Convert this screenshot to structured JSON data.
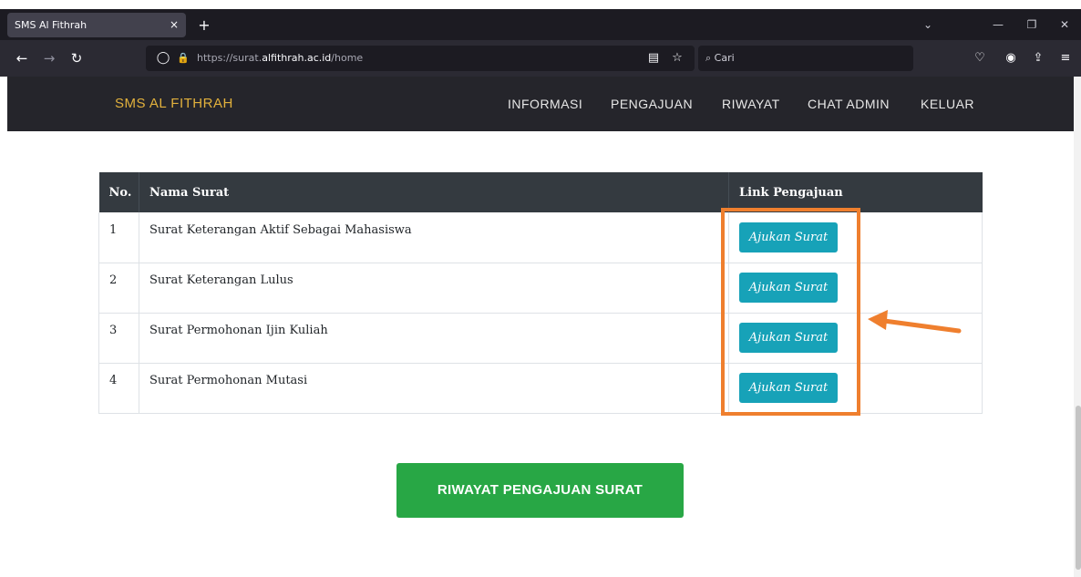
{
  "browser": {
    "tab_title": "SMS Al Fithrah",
    "tab_close": "×",
    "new_tab": "+",
    "url_prefix": "https://surat.",
    "url_domain": "alfithrah.ac.id",
    "url_path": "/home",
    "search_placeholder": "Cari",
    "icons": {
      "back": "←",
      "forward": "→",
      "reload": "↻",
      "shield": "◯",
      "lock": "🔒",
      "reader": "▤",
      "star": "☆",
      "search": "⌕",
      "pocket": "♡",
      "account": "◉",
      "share": "⇪",
      "menu": "≡",
      "tabs_list": "⌄",
      "minimize": "—",
      "restore": "❐",
      "close": "✕"
    }
  },
  "site": {
    "brand": "SMS AL FITHRAH",
    "menu": [
      "INFORMASI",
      "PENGAJUAN",
      "RIWAYAT",
      "CHAT ADMIN",
      "KELUAR"
    ]
  },
  "table": {
    "headers": [
      "No.",
      "Nama Surat",
      "Link Pengajuan"
    ],
    "rows": [
      {
        "no": "1",
        "name": "Surat Keterangan Aktif Sebagai Mahasiswa",
        "action": "Ajukan Surat"
      },
      {
        "no": "2",
        "name": "Surat Keterangan Lulus",
        "action": "Ajukan Surat"
      },
      {
        "no": "3",
        "name": "Surat Permohonan Ijin Kuliah",
        "action": "Ajukan Surat"
      },
      {
        "no": "4",
        "name": "Surat Permohonan Mutasi",
        "action": "Ajukan Surat"
      }
    ]
  },
  "footer_button": "RIWAYAT PENGAJUAN SURAT",
  "colors": {
    "brand": "#e2b13c",
    "header_bg": "#25252b",
    "table_head": "#343a40",
    "action_button": "#17a2b8",
    "primary_button": "#28a745",
    "annotation": "#ef7f2e"
  }
}
